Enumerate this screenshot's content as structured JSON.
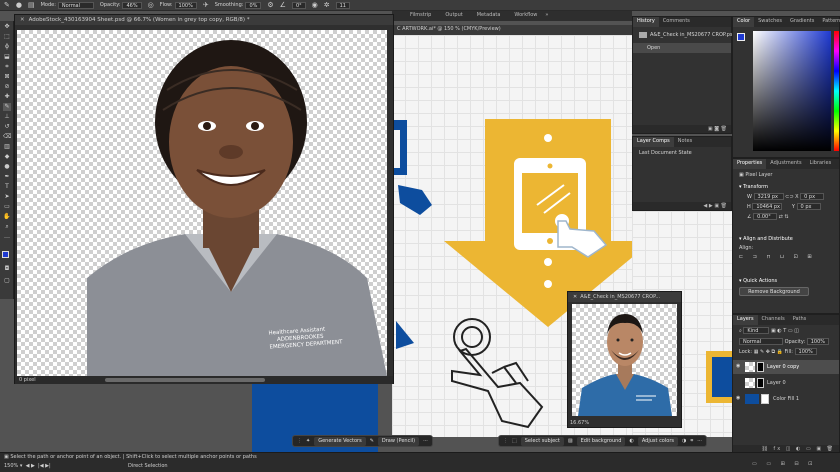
{
  "options_bar": {
    "mode_label": "Mode:",
    "mode_value": "Normal",
    "opacity_label": "Opacity:",
    "opacity_value": "46%",
    "flow_label": "Flow:",
    "flow_value": "100%",
    "smoothing_label": "Smoothing:",
    "smoothing_value": "0%",
    "angle_value": "0°",
    "size_value": "11"
  },
  "doc_tabs": [
    "Filmstrip",
    "Output",
    "Metadata",
    "Workflow"
  ],
  "portrait_window": {
    "title": "AdobeStock_430163904 Sheet.psd @ 66.7% (Women in grey top copy, RGB/8) *",
    "shirt_text_1": "Healthcare Assistant",
    "shirt_text_2": "ADDENBROOKES",
    "shirt_text_3": "EMERGENCY DEPARTMENT",
    "status": "0 pixel"
  },
  "artboard_title": "C ARTWORK.ai* @ 150 % (CMYK/Preview)",
  "small_window": {
    "title": "A&E_Check in_MS20677 CROP...",
    "zoom": "16.67%"
  },
  "history_panel": {
    "tabs": [
      "History",
      "Comments"
    ],
    "snapshot": "A&E_Check in_MS20677 CROP.psd",
    "items": [
      "Open"
    ]
  },
  "layer_comps_panel": {
    "tabs": [
      "Layer Comps",
      "Notes"
    ],
    "items": [
      "Last Document State"
    ]
  },
  "color_panel": {
    "tabs": [
      "Color",
      "Swatches",
      "Gradients",
      "Patterns"
    ],
    "hue_color": "#1f3ad2"
  },
  "properties_panel": {
    "tabs": [
      "Properties",
      "Adjustments",
      "Libraries"
    ],
    "type": "Pixel Layer",
    "transform_label": "Transform",
    "w_value": "3219 px",
    "h_value": "10464 px",
    "x_value": "0 px",
    "y_value": "0 px",
    "angle_value": "0.00°",
    "align_label": "Align and Distribute",
    "align_sub": "Align:",
    "quick_label": "Quick Actions",
    "quick_button": "Remove Background"
  },
  "layers_panel": {
    "tabs": [
      "Layers",
      "Channels",
      "Paths"
    ],
    "kind": "Kind",
    "blend": "Normal",
    "opacity_label": "Opacity:",
    "opacity_value": "100%",
    "lock_label": "Lock:",
    "fill_label": "Fill:",
    "fill_value": "100%",
    "layers": [
      "Layer 0 copy",
      "Layer 0",
      "Color Fill 1"
    ]
  },
  "contextual_bars": {
    "ai": {
      "generate": "Generate Vectors",
      "draw": "Draw (Pencil)"
    },
    "ps": {
      "select": "Select subject",
      "edit_bg": "Edit background",
      "adjust": "Adjust colors"
    }
  },
  "status_bar": {
    "message_1": "Select the path or anchor point of an object. | Shift+Click to select multiple anchor points or paths",
    "zoom": "150%",
    "tool": "Direct Selection"
  },
  "colors": {
    "navy": "#0d4d9e",
    "gold": "#ecb633",
    "scrub": "#8fb7dd"
  }
}
